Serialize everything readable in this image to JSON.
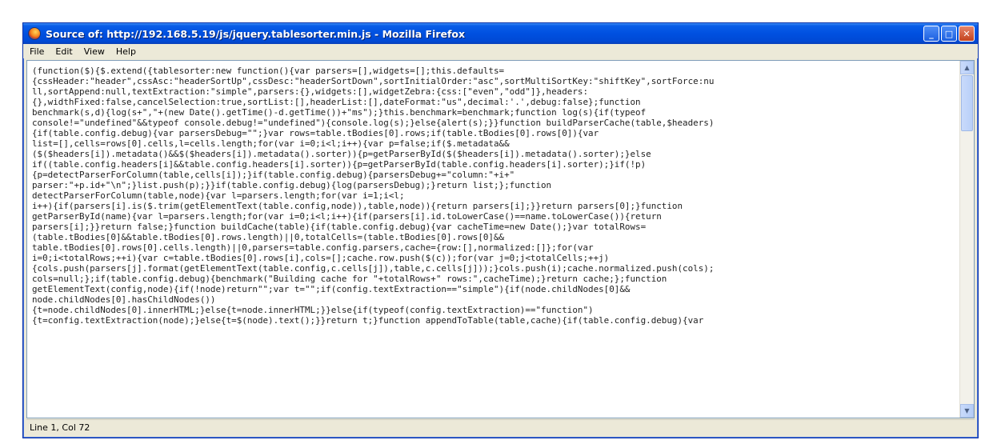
{
  "window": {
    "title": "Source of: http://192.168.5.19/js/jquery.tablesorter.min.js - Mozilla Firefox",
    "icon": "firefox-icon"
  },
  "controls": {
    "minimize": "_",
    "maximize": "□",
    "close": "✕"
  },
  "menu": {
    "file": "File",
    "edit": "Edit",
    "view": "View",
    "help": "Help"
  },
  "source_lines": [
    "(function($){$.extend({tablesorter:new function(){var parsers=[],widgets=[];this.defaults=",
    "{cssHeader:\"header\",cssAsc:\"headerSortUp\",cssDesc:\"headerSortDown\",sortInitialOrder:\"asc\",sortMultiSortKey:\"shiftKey\",sortForce:nu",
    "ll,sortAppend:null,textExtraction:\"simple\",parsers:{},widgets:[],widgetZebra:{css:[\"even\",\"odd\"]},headers:",
    "{},widthFixed:false,cancelSelection:true,sortList:[],headerList:[],dateFormat:\"us\",decimal:'.',debug:false};function",
    "benchmark(s,d){log(s+\",\"+(new Date().getTime()-d.getTime())+\"ms\");}this.benchmark=benchmark;function log(s){if(typeof",
    "console!=\"undefined\"&&typeof console.debug!=\"undefined\"){console.log(s);}else{alert(s);}}function buildParserCache(table,$headers)",
    "{if(table.config.debug){var parsersDebug=\"\";}var rows=table.tBodies[0].rows;if(table.tBodies[0].rows[0]){var",
    "list=[],cells=rows[0].cells,l=cells.length;for(var i=0;i<l;i++){var p=false;if($.metadata&&",
    "($($headers[i]).metadata()&&$($headers[i]).metadata().sorter)){p=getParserById($($headers[i]).metadata().sorter);}else",
    "if((table.config.headers[i]&&table.config.headers[i].sorter)){p=getParserById(table.config.headers[i].sorter);}if(!p)",
    "{p=detectParserForColumn(table,cells[i]);}if(table.config.debug){parsersDebug+=\"column:\"+i+\"",
    "parser:\"+p.id+\"\\n\";}list.push(p);}}if(table.config.debug){log(parsersDebug);}return list;};function",
    "detectParserForColumn(table,node){var l=parsers.length;for(var i=1;i<l;",
    "i++){if(parsers[i].is($.trim(getElementText(table.config,node)),table,node)){return parsers[i];}}return parsers[0];}function",
    "getParserById(name){var l=parsers.length;for(var i=0;i<l;i++){if(parsers[i].id.toLowerCase()==name.toLowerCase()){return",
    "parsers[i];}}return false;}function buildCache(table){if(table.config.debug){var cacheTime=new Date();}var totalRows=",
    "(table.tBodies[0]&&table.tBodies[0].rows.length)||0,totalCells=(table.tBodies[0].rows[0]&&",
    "table.tBodies[0].rows[0].cells.length)||0,parsers=table.config.parsers,cache={row:[],normalized:[]};for(var",
    "i=0;i<totalRows;++i){var c=table.tBodies[0].rows[i],cols=[];cache.row.push($(c));for(var j=0;j<totalCells;++j)",
    "{cols.push(parsers[j].format(getElementText(table.config,c.cells[j]),table,c.cells[j]));}cols.push(i);cache.normalized.push(cols);",
    "cols=null;};if(table.config.debug){benchmark(\"Building cache for \"+totalRows+\" rows:\",cacheTime);}return cache;};function",
    "getElementText(config,node){if(!node)return\"\";var t=\"\";if(config.textExtraction==\"simple\"){if(node.childNodes[0]&&",
    "node.childNodes[0].hasChildNodes())",
    "{t=node.childNodes[0].innerHTML;}else{t=node.innerHTML;}}else{if(typeof(config.textExtraction)==\"function\")",
    "{t=config.textExtraction(node);}else{t=$(node).text();}}return t;}function appendToTable(table,cache){if(table.config.debug){var"
  ],
  "status": {
    "position": "Line 1, Col 72"
  }
}
